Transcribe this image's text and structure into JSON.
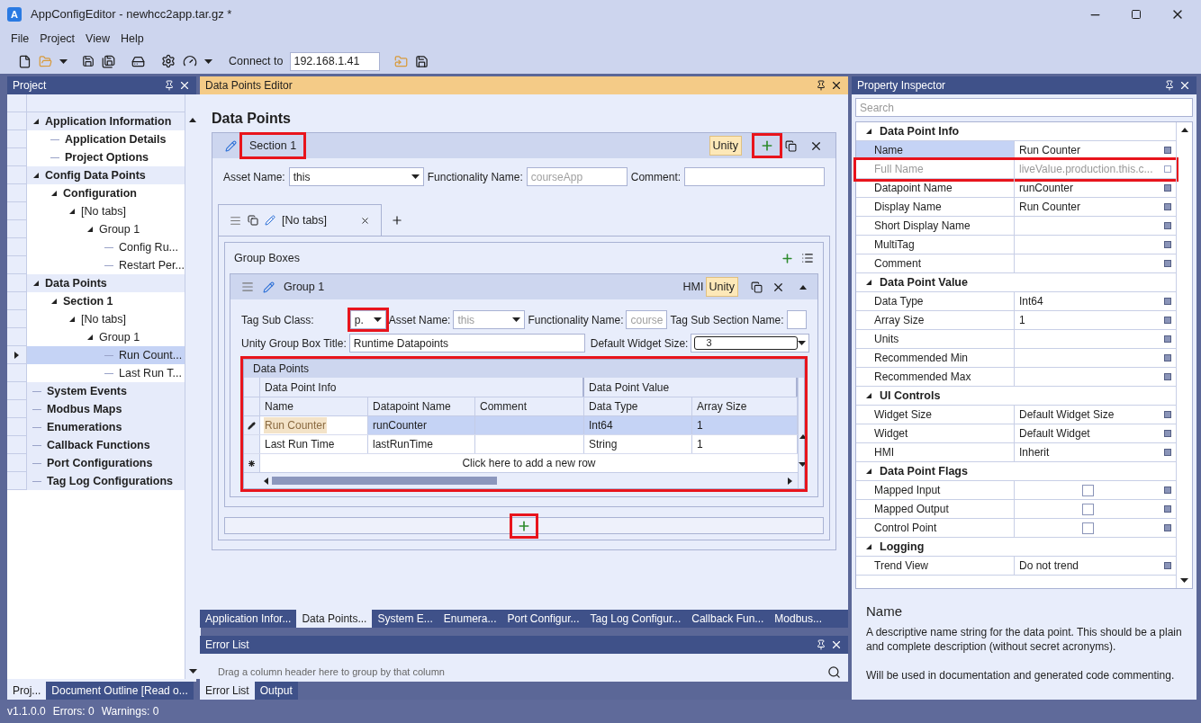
{
  "window": {
    "logo": "A",
    "title": "AppConfigEditor - newhcc2app.tar.gz *"
  },
  "menu": [
    "File",
    "Project",
    "View",
    "Help"
  ],
  "toolbar": {
    "connect_label": "Connect to",
    "address": "192.168.1.41"
  },
  "project_panel": {
    "title": "Project",
    "tree": [
      {
        "label": "Application Information",
        "bold": true,
        "selected": false,
        "expanded": true,
        "children": [
          {
            "label": "Application Details",
            "bold": true,
            "selected": false
          },
          {
            "label": "Project Options",
            "bold": true,
            "selected": false
          }
        ]
      },
      {
        "label": "Config Data Points",
        "bold": true,
        "selected": false,
        "expanded": true,
        "children": [
          {
            "label": "Configuration",
            "bold": true,
            "selected": false,
            "expanded": true,
            "children": [
              {
                "label": "[No tabs]",
                "bold": false,
                "selected": false,
                "expanded": true,
                "children": [
                  {
                    "label": "Group 1",
                    "bold": false,
                    "selected": false,
                    "expanded": true,
                    "children": [
                      {
                        "label": "Config Ru...",
                        "bold": false,
                        "selected": false
                      },
                      {
                        "label": "Restart Per...",
                        "bold": false,
                        "selected": false
                      }
                    ]
                  }
                ]
              }
            ]
          }
        ]
      },
      {
        "label": "Data Points",
        "bold": true,
        "selected": false,
        "expanded": true,
        "children": [
          {
            "label": "Section 1",
            "bold": true,
            "selected": false,
            "expanded": true,
            "children": [
              {
                "label": "[No tabs]",
                "bold": false,
                "selected": false,
                "expanded": true,
                "children": [
                  {
                    "label": "Group 1",
                    "bold": false,
                    "selected": false,
                    "expanded": true,
                    "children": [
                      {
                        "label": "Run Count...",
                        "bold": false,
                        "selected": true
                      },
                      {
                        "label": "Last Run T...",
                        "bold": false,
                        "selected": false
                      }
                    ]
                  }
                ]
              }
            ]
          }
        ]
      },
      {
        "label": "System Events",
        "bold": true,
        "selected": false
      },
      {
        "label": "Modbus Maps",
        "bold": true,
        "selected": false
      },
      {
        "label": "Enumerations",
        "bold": true,
        "selected": false
      },
      {
        "label": "Callback Functions",
        "bold": true,
        "selected": false
      },
      {
        "label": "Port Configurations",
        "bold": true,
        "selected": false
      },
      {
        "label": "Tag Log Configurations",
        "bold": true,
        "selected": false
      }
    ],
    "tabs": [
      {
        "label": "Proj...",
        "selected": true
      },
      {
        "label": "Document Outline [Read o...",
        "selected": false
      }
    ]
  },
  "editor": {
    "title": "Data Points Editor",
    "heading": "Data Points",
    "section": {
      "title": "Section 1",
      "title_highlighted": true,
      "badge": "Unity",
      "add_highlighted": true,
      "asset_label": "Asset Name:",
      "asset_value": "this",
      "functionality_label": "Functionality Name:",
      "functionality_placeholder": "courseApp",
      "comment_label": "Comment:",
      "tab": {
        "label": "[No tabs]",
        "selected": true
      },
      "group_boxes_label": "Group Boxes",
      "group": {
        "title": "Group 1",
        "hmi": "HMI",
        "badge": "Unity",
        "tag_sub_class_label": "Tag Sub Class:",
        "tag_sub_class_value": "p.",
        "tag_sub_class_highlighted": true,
        "asset_label": "Asset Name:",
        "asset_value": "this",
        "asset_disabled": true,
        "functionality_label": "Functionality Name:",
        "functionality_placeholder": "course",
        "sub_section_label": "Tag Sub Section Name:",
        "title_label": "Unity Group Box Title:",
        "title_value": "Runtime Datapoints",
        "widget_size_label": "Default Widget Size:",
        "widget_size_value": "3",
        "grid": {
          "title": "Data Points",
          "highlighted": true,
          "bands": [
            {
              "label": "Data Point Info",
              "columns": [
                "Name",
                "Datapoint Name",
                "Comment"
              ]
            },
            {
              "label": "Data Point Value",
              "columns": [
                "Data Type",
                "Array Size"
              ]
            }
          ],
          "rows": [
            {
              "cells": [
                "Run Counter",
                "runCounter",
                "",
                "Int64",
                "1"
              ],
              "selected": true,
              "editing": true
            },
            {
              "cells": [
                "Last Run Time",
                "lastRunTime",
                "",
                "String",
                "1"
              ],
              "selected": false,
              "editing": false
            }
          ],
          "new_row": "Click here to add a new row"
        }
      },
      "add_group_highlighted": true
    }
  },
  "doc_tabs": [
    {
      "label": "Application Infor...",
      "selected": false
    },
    {
      "label": "Data Points...",
      "selected": true
    },
    {
      "label": "System E...",
      "selected": false
    },
    {
      "label": "Enumera...",
      "selected": false
    },
    {
      "label": "Port Configur...",
      "selected": false
    },
    {
      "label": "Tag Log Configur...",
      "selected": false
    },
    {
      "label": "Callback Fun...",
      "selected": false
    },
    {
      "label": "Modbus...",
      "selected": false
    }
  ],
  "error_list": {
    "title": "Error List",
    "hint": "Drag a column header here to group by that column",
    "tabs": [
      {
        "label": "Error List",
        "selected": true
      },
      {
        "label": "Output",
        "selected": false
      }
    ]
  },
  "inspector": {
    "title": "Property Inspector",
    "search_placeholder": "Search",
    "categories": [
      {
        "label": "Data Point Info",
        "expanded": true,
        "rows": [
          {
            "name": "Name",
            "value": "Run Counter",
            "kind": "text",
            "selected": true,
            "disabled": false,
            "highlighted": false
          },
          {
            "name": "Full Name",
            "value": "liveValue.production.this.c...",
            "kind": "text",
            "selected": false,
            "disabled": true,
            "highlighted": true
          },
          {
            "name": "Datapoint Name",
            "value": "runCounter",
            "kind": "text",
            "selected": false,
            "disabled": false,
            "highlighted": false
          },
          {
            "name": "Display Name",
            "value": "Run Counter",
            "kind": "text",
            "selected": false,
            "disabled": false,
            "highlighted": false
          },
          {
            "name": "Short Display Name",
            "kind": "text",
            "selected": false,
            "disabled": false,
            "highlighted": false
          },
          {
            "name": "MultiTag",
            "kind": "text",
            "selected": false,
            "disabled": false,
            "highlighted": false
          },
          {
            "name": "Comment",
            "kind": "text",
            "selected": false,
            "disabled": false,
            "highlighted": false
          }
        ]
      },
      {
        "label": "Data Point Value",
        "expanded": true,
        "rows": [
          {
            "name": "Data Type",
            "value": "Int64",
            "kind": "text",
            "selected": false,
            "disabled": false,
            "highlighted": false
          },
          {
            "name": "Array Size",
            "value": "1",
            "kind": "text",
            "selected": false,
            "disabled": false,
            "highlighted": false
          },
          {
            "name": "Units",
            "kind": "text",
            "selected": false,
            "disabled": false,
            "highlighted": false
          },
          {
            "name": "Recommended Min",
            "kind": "text",
            "selected": false,
            "disabled": false,
            "highlighted": false
          },
          {
            "name": "Recommended Max",
            "kind": "text",
            "selected": false,
            "disabled": false,
            "highlighted": false
          }
        ]
      },
      {
        "label": "UI Controls",
        "expanded": true,
        "rows": [
          {
            "name": "Widget Size",
            "value": "Default Widget Size",
            "kind": "text",
            "selected": false,
            "disabled": false,
            "highlighted": false
          },
          {
            "name": "Widget",
            "value": "Default Widget",
            "kind": "text",
            "selected": false,
            "disabled": false,
            "highlighted": false
          },
          {
            "name": "HMI",
            "value": "Inherit",
            "kind": "text",
            "selected": false,
            "disabled": false,
            "highlighted": false
          }
        ]
      },
      {
        "label": "Data Point Flags",
        "expanded": true,
        "rows": [
          {
            "name": "Mapped Input",
            "kind": "checkbox",
            "checked": false,
            "selected": false,
            "disabled": false,
            "highlighted": false
          },
          {
            "name": "Mapped Output",
            "kind": "checkbox",
            "checked": false,
            "selected": false,
            "disabled": false,
            "highlighted": false
          },
          {
            "name": "Control Point",
            "kind": "checkbox",
            "checked": false,
            "selected": false,
            "disabled": false,
            "highlighted": false
          }
        ]
      },
      {
        "label": "Logging",
        "expanded": true,
        "rows": [
          {
            "name": "Trend View",
            "value": "Do not trend",
            "kind": "text",
            "selected": false,
            "disabled": false,
            "highlighted": false
          }
        ]
      }
    ],
    "description": {
      "title": "Name",
      "paragraphs": [
        "A descriptive name string for the data point. This should be a plain and complete description (without secret acronyms).",
        "Will be used in documentation and generated code commenting."
      ]
    }
  },
  "status_bar": [
    "v1.1.0.0",
    "Errors: 0",
    "Warnings: 0"
  ]
}
